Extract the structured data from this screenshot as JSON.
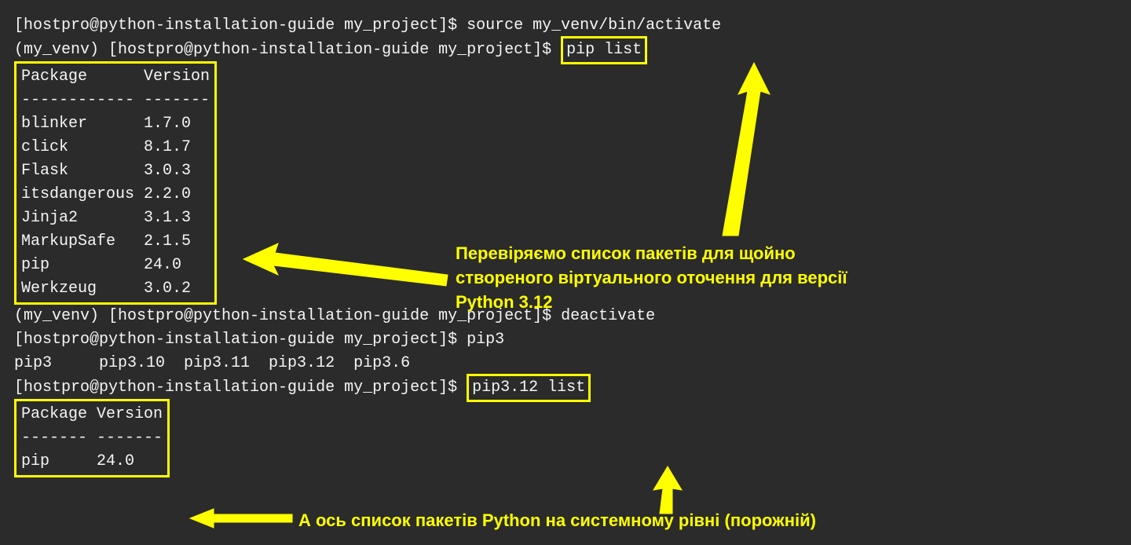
{
  "lines": {
    "l1_prompt": "[hostpro@python-installation-guide my_project]$ ",
    "l1_cmd": "source my_venv/bin/activate",
    "l2_prompt": "(my_venv) [hostpro@python-installation-guide my_project]$ ",
    "l2_cmd": "pip list",
    "pkg_header": "Package      Version",
    "pkg_sep": "------------ -------",
    "pkg_rows": [
      "blinker      1.7.0",
      "click        8.1.7",
      "Flask        3.0.3",
      "itsdangerous 2.2.0",
      "Jinja2       3.1.3",
      "MarkupSafe   2.1.5",
      "pip          24.0",
      "Werkzeug     3.0.2"
    ],
    "l3_prompt": "(my_venv) [hostpro@python-installation-guide my_project]$ ",
    "l3_cmd": "deactivate",
    "l4_prompt": "[hostpro@python-installation-guide my_project]$ ",
    "l4_cmd": "pip3",
    "l5_out": "pip3     pip3.10  pip3.11  pip3.12  pip3.6",
    "l6_prompt": "[hostpro@python-installation-guide my_project]$ ",
    "l6_cmd": "pip3.12 list",
    "pkg2_header": "Package Version",
    "pkg2_sep": "------- -------",
    "pkg2_rows": [
      "pip     24.0"
    ]
  },
  "annotations": {
    "a1": "Перевіряємо список пакетів для щойно створеного віртуального оточення для версії Python 3.12",
    "a2": "А ось список пакетів Python на системному рівні (порожній)"
  }
}
